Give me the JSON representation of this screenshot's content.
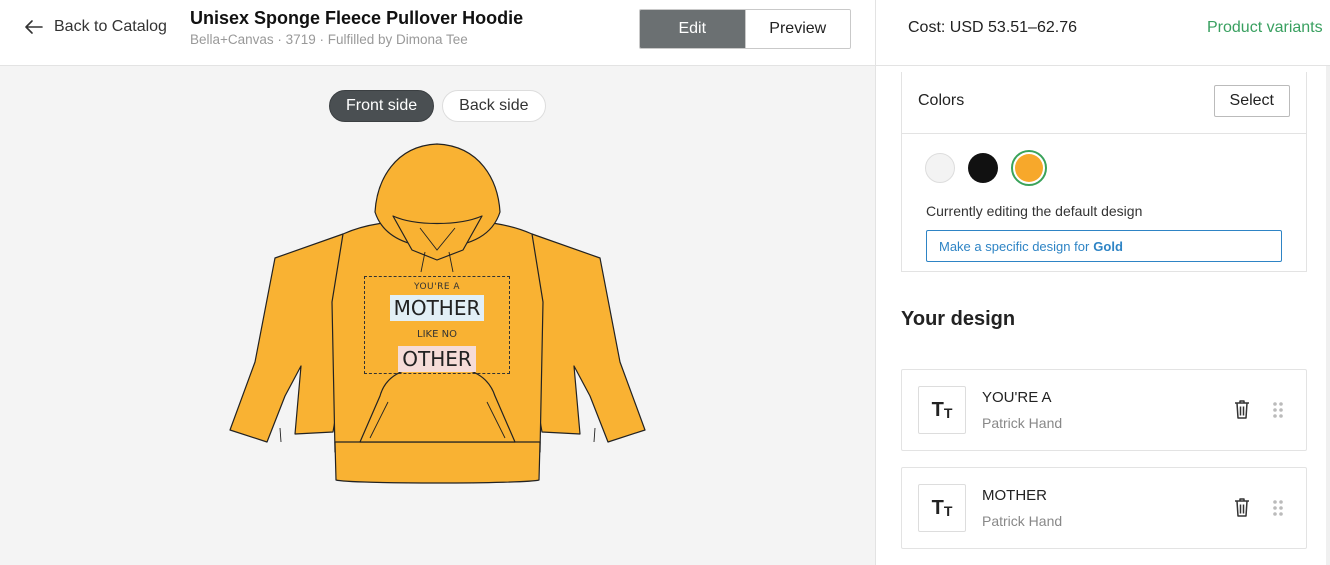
{
  "header": {
    "back_label": "Back to Catalog",
    "title": "Unisex Sponge Fleece Pullover Hoodie",
    "subtitle": "Bella+Canvas · 3719 · Fulfilled by Dimona Tee",
    "edit_label": "Edit",
    "preview_label": "Preview"
  },
  "canvas": {
    "front_label": "Front side",
    "back_label": "Back side",
    "product_color": "#f9b233",
    "design_lines": [
      "YOU'RE A",
      "MOTHER",
      "LIKE NO",
      "OTHER"
    ]
  },
  "panel": {
    "cost": "Cost: USD 53.51–62.76",
    "variants_link": "Product variants",
    "colors_label": "Colors",
    "select_label": "Select",
    "swatches": [
      {
        "name": "White",
        "hex": "#f3f3f3"
      },
      {
        "name": "Black",
        "hex": "#111111"
      },
      {
        "name": "Gold",
        "hex": "#f7a82b",
        "selected": true
      }
    ],
    "editing_note": "Currently editing the default design",
    "specific_prefix": "Make a specific design for",
    "specific_color": "Gold",
    "your_design_title": "Your design",
    "layers": [
      {
        "text": "YOU'RE A",
        "font": "Patrick Hand"
      },
      {
        "text": "MOTHER",
        "font": "Patrick Hand"
      }
    ]
  },
  "colors": {
    "accent_green": "#39a060",
    "link_blue": "#2e84c5",
    "edit_active_bg": "#6b7072"
  }
}
